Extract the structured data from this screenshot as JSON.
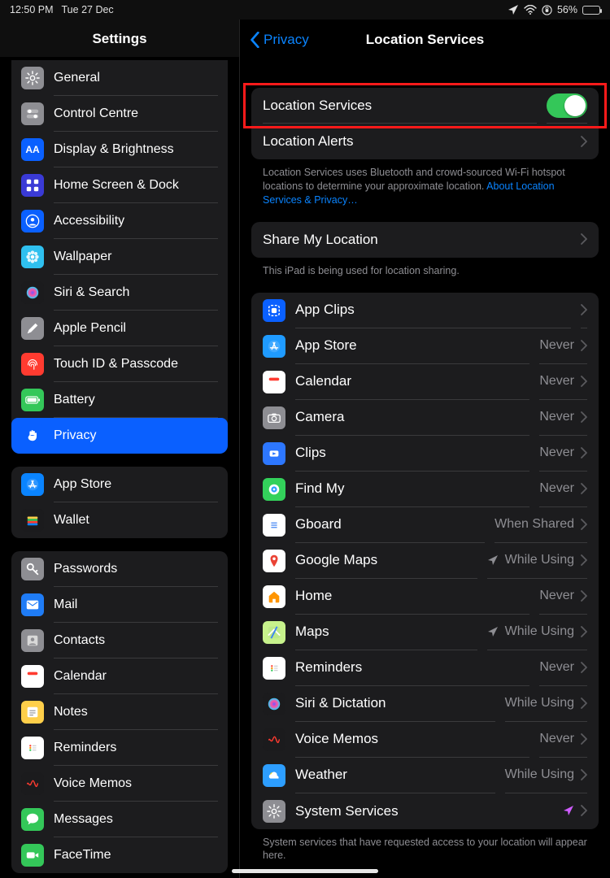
{
  "statusbar": {
    "time": "12:50 PM",
    "date": "Tue 27 Dec",
    "battery_pct": "56%",
    "battery_fill_pct": 56
  },
  "sidebar": {
    "title": "Settings",
    "groups": [
      {
        "first": true,
        "items": [
          {
            "id": "general",
            "label": "General",
            "icon": "gear",
            "bg": "#8e8e93"
          },
          {
            "id": "control-centre",
            "label": "Control Centre",
            "icon": "switches",
            "bg": "#8e8e93"
          },
          {
            "id": "display",
            "label": "Display & Brightness",
            "icon": "aa",
            "bg": "#0a60ff"
          },
          {
            "id": "home-screen",
            "label": "Home Screen & Dock",
            "icon": "grid",
            "bg": "#3a3ad6"
          },
          {
            "id": "accessibility",
            "label": "Accessibility",
            "icon": "person",
            "bg": "#0a60ff"
          },
          {
            "id": "wallpaper",
            "label": "Wallpaper",
            "icon": "flower",
            "bg": "#2fc0ef"
          },
          {
            "id": "siri",
            "label": "Siri & Search",
            "icon": "siri",
            "bg": "#1b1b1d"
          },
          {
            "id": "pencil",
            "label": "Apple Pencil",
            "icon": "pencil",
            "bg": "#8e8e93"
          },
          {
            "id": "touchid",
            "label": "Touch ID & Passcode",
            "icon": "fingerprint",
            "bg": "#ff3b30"
          },
          {
            "id": "battery",
            "label": "Battery",
            "icon": "battery",
            "bg": "#34c759"
          },
          {
            "id": "privacy",
            "label": "Privacy",
            "icon": "hand",
            "bg": "#0a60ff",
            "selected": true
          }
        ]
      },
      {
        "items": [
          {
            "id": "appstore",
            "label": "App Store",
            "icon": "appstore",
            "bg": "#0a84ff"
          },
          {
            "id": "wallet",
            "label": "Wallet",
            "icon": "wallet",
            "bg": "#1b1b1d"
          }
        ]
      },
      {
        "items": [
          {
            "id": "passwords",
            "label": "Passwords",
            "icon": "key",
            "bg": "#8e8e93"
          },
          {
            "id": "mail",
            "label": "Mail",
            "icon": "mail",
            "bg": "#1f7cf6"
          },
          {
            "id": "contacts",
            "label": "Contacts",
            "icon": "contacts",
            "bg": "#8e8e93"
          },
          {
            "id": "calendar-app",
            "label": "Calendar",
            "icon": "calendar",
            "bg": "#ffffff"
          },
          {
            "id": "notes",
            "label": "Notes",
            "icon": "notes",
            "bg": "#ffcf4a"
          },
          {
            "id": "reminders-app",
            "label": "Reminders",
            "icon": "reminders",
            "bg": "#ffffff"
          },
          {
            "id": "voice-memos-app",
            "label": "Voice Memos",
            "icon": "voicememo",
            "bg": "#1b1b1d"
          },
          {
            "id": "messages",
            "label": "Messages",
            "icon": "messages",
            "bg": "#34c759"
          },
          {
            "id": "facetime",
            "label": "FaceTime",
            "icon": "facetime",
            "bg": "#34c759"
          }
        ]
      }
    ]
  },
  "detail": {
    "back": "Privacy",
    "title": "Location Services",
    "rows_main": [
      {
        "id": "loc-services",
        "label": "Location Services",
        "control": "toggle",
        "toggle_on": true,
        "highlighted": true
      },
      {
        "id": "loc-alerts",
        "label": "Location Alerts",
        "control": "chevron"
      }
    ],
    "help_text": "Location Services uses Bluetooth and crowd-sourced Wi-Fi hotspot locations to determine your approximate location. ",
    "help_link": "About Location Services & Privacy…",
    "share_row": {
      "id": "share-location",
      "label": "Share My Location"
    },
    "share_footer": "This iPad is being used for location sharing.",
    "apps": [
      {
        "id": "appclips",
        "label": "App Clips",
        "status": "",
        "icon": "appclips",
        "bg": "#0a60ff"
      },
      {
        "id": "appstore2",
        "label": "App Store",
        "status": "Never",
        "icon": "appstore",
        "bg": "#1f9bff"
      },
      {
        "id": "calendar",
        "label": "Calendar",
        "status": "Never",
        "icon": "cal",
        "bg": "#ffffff"
      },
      {
        "id": "camera",
        "label": "Camera",
        "status": "Never",
        "icon": "camera",
        "bg": "#8e8e93"
      },
      {
        "id": "clips",
        "label": "Clips",
        "status": "Never",
        "icon": "clips",
        "bg": "#2d77ff"
      },
      {
        "id": "findmy",
        "label": "Find My",
        "status": "Never",
        "icon": "findmy",
        "bg": "#33d15b"
      },
      {
        "id": "gboard",
        "label": "Gboard",
        "status": "When Shared",
        "icon": "gboard",
        "bg": "#ffffff"
      },
      {
        "id": "gmaps",
        "label": "Google Maps",
        "status": "While Using",
        "icon": "gmaps",
        "bg": "#ffffff",
        "arrow": "gray"
      },
      {
        "id": "home",
        "label": "Home",
        "status": "Never",
        "icon": "home",
        "bg": "#ffffff"
      },
      {
        "id": "maps",
        "label": "Maps",
        "status": "While Using",
        "icon": "maps",
        "bg": "#c7f28c",
        "arrow": "gray"
      },
      {
        "id": "reminders",
        "label": "Reminders",
        "status": "Never",
        "icon": "reminders",
        "bg": "#ffffff"
      },
      {
        "id": "siri2",
        "label": "Siri & Dictation",
        "status": "While Using",
        "icon": "siri",
        "bg": "#1b1b1d"
      },
      {
        "id": "voicememos",
        "label": "Voice Memos",
        "status": "Never",
        "icon": "voicememo",
        "bg": "#1b1b1d"
      },
      {
        "id": "weather",
        "label": "Weather",
        "status": "While Using",
        "icon": "weather",
        "bg": "#2d9eff"
      },
      {
        "id": "system",
        "label": "System Services",
        "status": "",
        "icon": "gear",
        "bg": "#8e8e93",
        "arrow": "purple"
      }
    ],
    "apps_footer": "System services that have requested access to your location will appear here."
  }
}
